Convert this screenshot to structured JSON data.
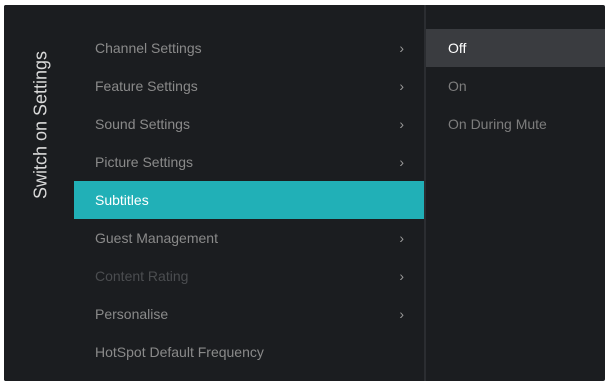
{
  "panel_title": "Switch on Settings",
  "menu": {
    "items": [
      {
        "label": "Channel Settings",
        "chevron": "›"
      },
      {
        "label": "Feature Settings",
        "chevron": "›"
      },
      {
        "label": "Sound Settings",
        "chevron": "›"
      },
      {
        "label": "Picture Settings",
        "chevron": "›"
      },
      {
        "label": "Subtitles",
        "chevron": ""
      },
      {
        "label": "Guest Management",
        "chevron": "›"
      },
      {
        "label": "Content Rating",
        "chevron": "›"
      },
      {
        "label": "Personalise",
        "chevron": "›"
      },
      {
        "label": "HotSpot Default Frequency",
        "chevron": ""
      }
    ],
    "selected_index": 4,
    "disabled_index": 6
  },
  "options": {
    "items": [
      "Off",
      "On",
      "On During Mute"
    ],
    "active_index": 0
  },
  "colors": {
    "accent": "#21b0b7",
    "background": "#1b1d20"
  }
}
